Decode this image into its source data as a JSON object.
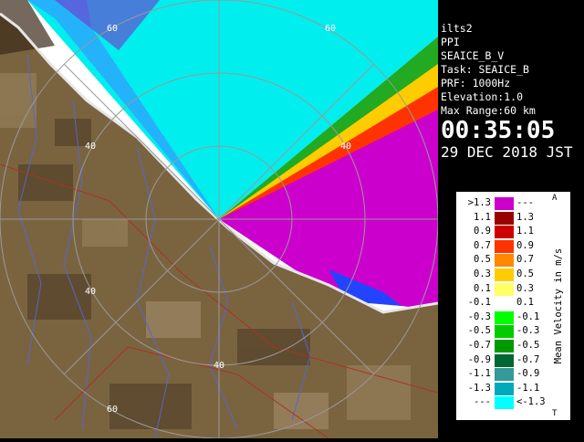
{
  "radar": {
    "range_labels": {
      "north": "60",
      "ne": "60",
      "west": "40",
      "nw_inner": "40",
      "south_inner": "40",
      "southwest": "40",
      "south": "60"
    }
  },
  "info": {
    "station": "ilts2",
    "mode": "PPI",
    "product": "SEAICE_B_V",
    "task": "Task: SEAICE_B",
    "prf": "PRF: 1000Hz",
    "elevation": "Elevation:1.0",
    "max_range": "Max Range:60 km",
    "time": "00:35:05",
    "date": "29 DEC 2018 JST"
  },
  "legend": {
    "title": "Mean Velocity in m/s",
    "unit_top": "A",
    "unit_bottom": "T",
    "rows": [
      {
        "lo": ">1.3",
        "hi": "---",
        "color": "#cc00cc"
      },
      {
        "lo": "1.1",
        "hi": "1.3",
        "color": "#990000"
      },
      {
        "lo": "0.9",
        "hi": "1.1",
        "color": "#cc0000"
      },
      {
        "lo": "0.7",
        "hi": "0.9",
        "color": "#ff3300"
      },
      {
        "lo": "0.5",
        "hi": "0.7",
        "color": "#ff8800"
      },
      {
        "lo": "0.3",
        "hi": "0.5",
        "color": "#ffcc00"
      },
      {
        "lo": "0.1",
        "hi": "0.3",
        "color": "#ffff66"
      },
      {
        "lo": "-0.1",
        "hi": "0.1",
        "color": "#ffffff"
      },
      {
        "lo": "-0.3",
        "hi": "-0.1",
        "color": "#00ff00"
      },
      {
        "lo": "-0.5",
        "hi": "-0.3",
        "color": "#00cc00"
      },
      {
        "lo": "-0.7",
        "hi": "-0.5",
        "color": "#009900"
      },
      {
        "lo": "-0.9",
        "hi": "-0.7",
        "color": "#006633"
      },
      {
        "lo": "-1.1",
        "hi": "-0.9",
        "color": "#339999"
      },
      {
        "lo": "-1.3",
        "hi": "-1.1",
        "color": "#00aabb"
      },
      {
        "lo": "---",
        "hi": "<-1.3",
        "color": "#00ffff"
      }
    ]
  }
}
